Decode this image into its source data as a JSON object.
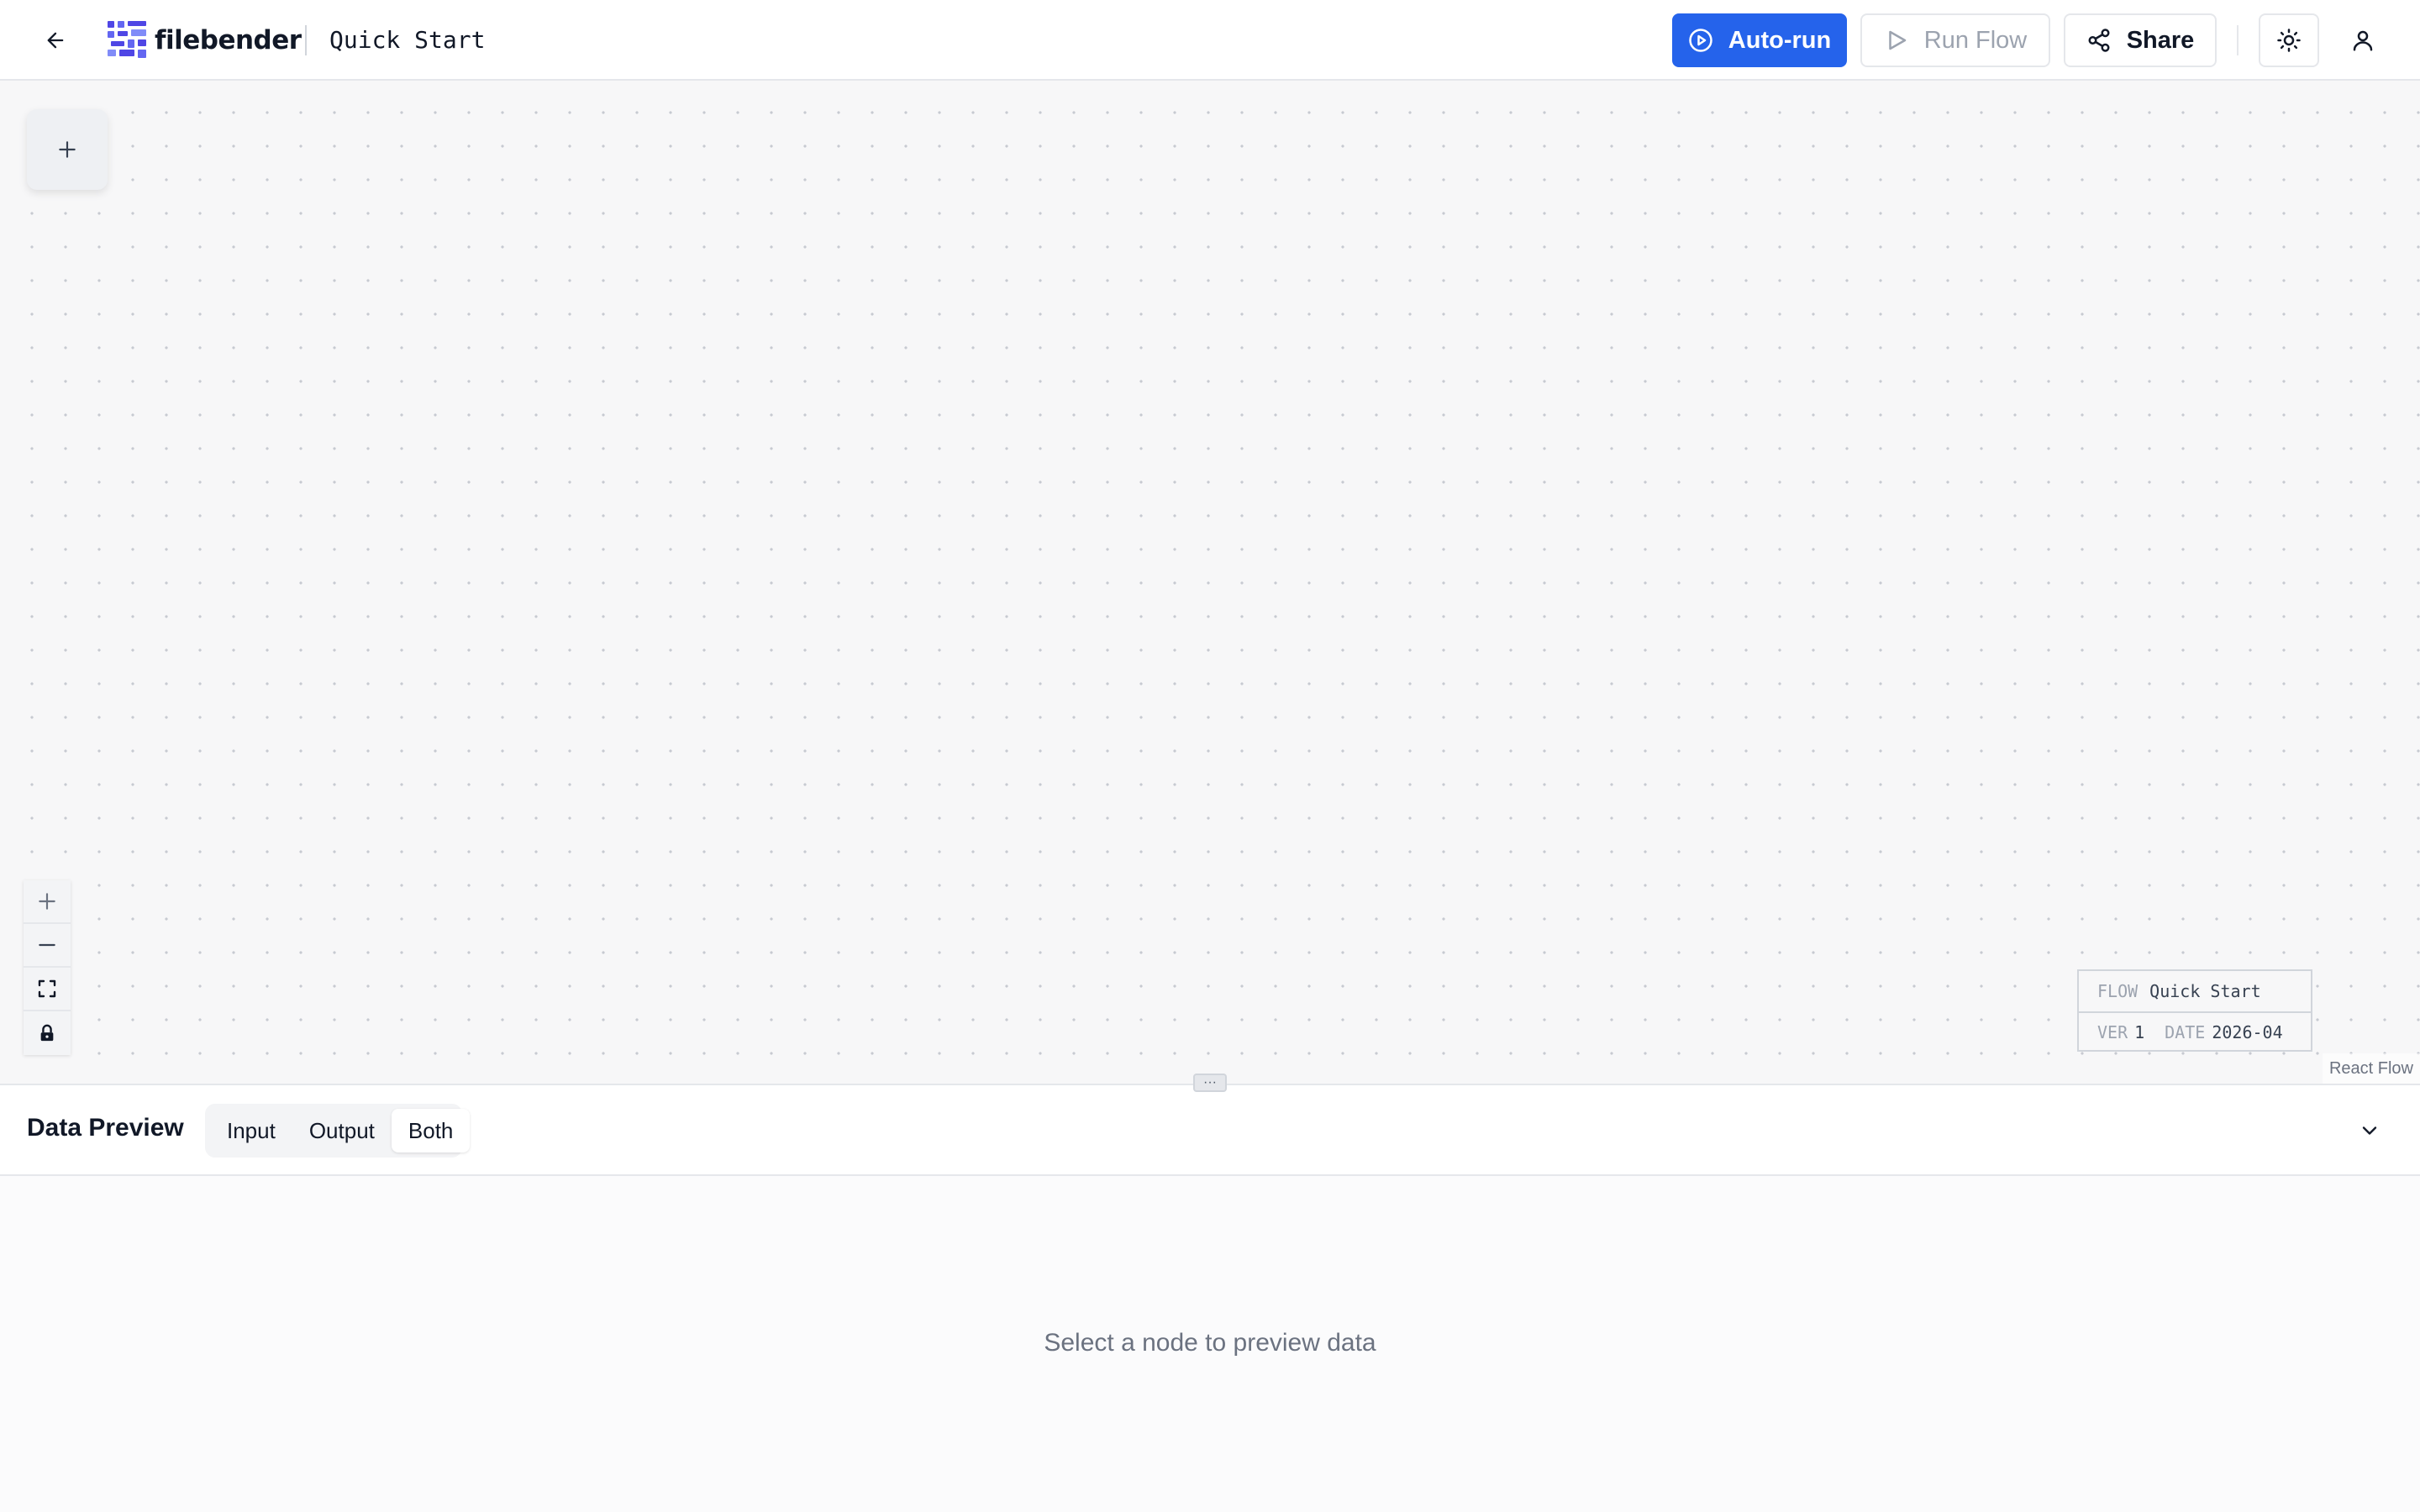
{
  "header": {
    "brand": "filebender",
    "flow_title": "Quick Start",
    "autorun_label": "Auto-run",
    "run_label": "Run Flow",
    "share_label": "Share",
    "accent_color": "#2563eb"
  },
  "canvas": {
    "info": {
      "flow_key": "FLOW",
      "flow_value": "Quick Start",
      "ver_key": "VER",
      "ver_value": "1",
      "date_key": "DATE",
      "date_value": "2026-04"
    },
    "attribution": "React Flow",
    "resize_glyph": "···"
  },
  "preview": {
    "title": "Data Preview",
    "tabs": [
      {
        "label": "Input",
        "active": false
      },
      {
        "label": "Output",
        "active": false
      },
      {
        "label": "Both",
        "active": true
      }
    ],
    "empty_message": "Select a node to preview data"
  }
}
